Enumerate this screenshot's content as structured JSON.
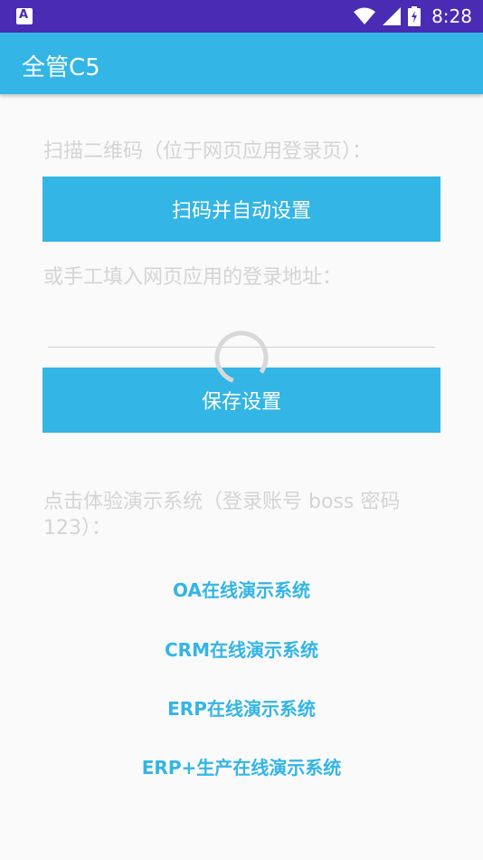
{
  "status_bar": {
    "time": "8:28",
    "notification_icon": "a-notification-icon",
    "icons": [
      "wifi-icon",
      "signal-icon",
      "battery-icon"
    ]
  },
  "app_bar": {
    "title": "全管C5"
  },
  "scan": {
    "prompt": "扫描二维码（位于网页应用登录页）：",
    "button_label": "扫码并自动设置"
  },
  "manual": {
    "prompt": "或手工填入网页应用的登录地址：",
    "input_value": "",
    "save_label": "保存设置"
  },
  "demo": {
    "prompt": "点击体验演示系统（登录账号 boss 密码 123）：",
    "links": [
      "OA在线演示系统",
      "CRM在线演示系统",
      "ERP在线演示系统",
      "ERP+生产在线演示系统"
    ]
  },
  "colors": {
    "accent": "#33b5e5",
    "status_bar": "#4a2bb4",
    "hint_text": "#d4d4d4"
  }
}
